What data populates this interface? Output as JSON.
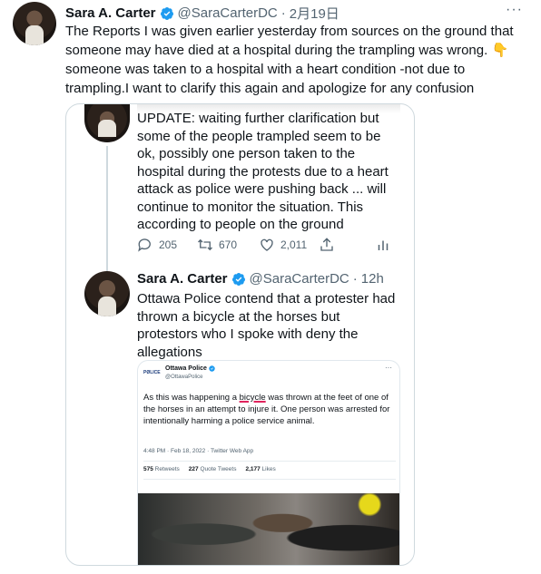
{
  "tweet": {
    "author_name": "Sara A. Carter",
    "handle": "@SaraCarterDC",
    "separator": "·",
    "date": "2月19日",
    "more_label": "···",
    "text_before_emoji": "The Reports I was given earlier yesterday from sources on the ground that someone may have died at a hospital during the trampling was wrong.",
    "emoji": "👇",
    "text_after_emoji": "someone was taken to a hospital with a heart condition -not due to trampling.I want to clarify this again and apologize for any confusion"
  },
  "quoted_thread": {
    "first_tweet": {
      "text": "UPDATE: waiting further clarification but some of the people trampled seem to be ok, possibly one person taken to the hospital during the protests due to a heart attack as police were pushing back ... will continue to monitor the situation. This according to people on the ground",
      "replies": "205",
      "retweets": "670",
      "likes": "2,011"
    },
    "second_tweet": {
      "author_name": "Sara A. Carter",
      "handle": "@SaraCarterDC",
      "separator": "·",
      "time": "12h",
      "text": "Ottawa Police contend that a protester had thrown a bicycle at the horses but protestors who I spoke with deny the allegations"
    },
    "embedded_screenshot": {
      "logo_text": "PØLICE",
      "author_name": "Ottawa Police",
      "handle": "@OttawaPolice",
      "more_label": "···",
      "text_before": "As this was happening a ",
      "underlined_word": "bicycle",
      "text_after": " was thrown at the feet of one of the horses in an attempt to injure it. One person was arrested for intentionally harming a police service animal.",
      "meta": "4:48 PM · Feb 18, 2022 · Twitter Web App",
      "retweets_count": "575",
      "retweets_label": "Retweets",
      "quotes_count": "227",
      "quotes_label": "Quote Tweets",
      "likes_count": "2,177",
      "likes_label": "Likes"
    }
  },
  "colors": {
    "verified_blue": "#1d9bf0",
    "secondary_text": "#536471",
    "border": "#cfd9de"
  }
}
